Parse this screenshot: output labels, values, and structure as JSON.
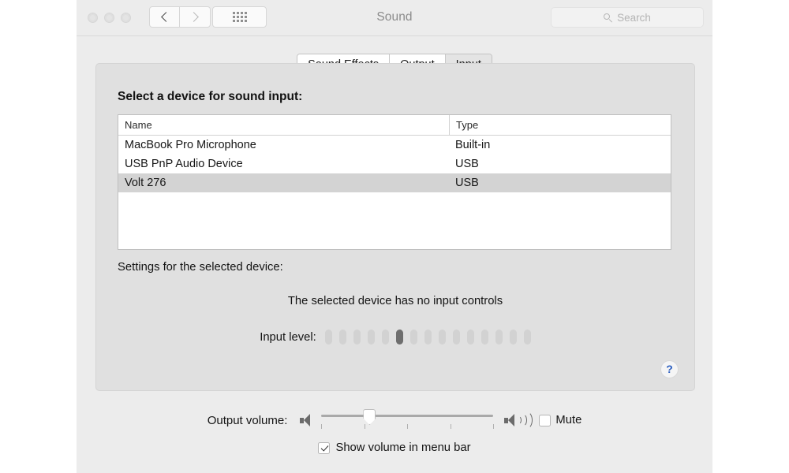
{
  "window": {
    "title": "Sound",
    "traffic_lights": [
      "close",
      "minimize",
      "zoom"
    ],
    "nav": {
      "back": "back-chevron",
      "forward": "forward-chevron",
      "grid": "show-all-grid"
    },
    "search": {
      "placeholder": "Search",
      "value": "",
      "icon": "search-icon"
    }
  },
  "tabs": [
    {
      "label": "Sound Effects",
      "selected": false
    },
    {
      "label": "Output",
      "selected": false
    },
    {
      "label": "Input",
      "selected": true
    }
  ],
  "main": {
    "section_title": "Select a device for sound input:",
    "table": {
      "columns": [
        "Name",
        "Type"
      ],
      "rows": [
        {
          "name": "MacBook Pro Microphone",
          "type": "Built-in",
          "selected": false
        },
        {
          "name": "USB PnP Audio Device",
          "type": "USB",
          "selected": false
        },
        {
          "name": "Volt 276",
          "type": "USB",
          "selected": true
        }
      ]
    },
    "settings_label": "Settings for the selected device:",
    "no_controls_message": "The selected device has no input controls",
    "input_level": {
      "label": "Input level:",
      "segments_total": 15,
      "segments_active_index": 6,
      "on_color": "#6e6e6e",
      "off_color": "#d2d2d2"
    },
    "help_button": {
      "glyph": "?",
      "color": "#2b5ec0"
    }
  },
  "footer": {
    "output_volume_label": "Output volume:",
    "slider": {
      "value_percent": 28,
      "ticks": 5
    },
    "low_icon": "speaker-low-icon",
    "high_icon": "speaker-high-icon",
    "mute": {
      "label": "Mute",
      "checked": false
    },
    "show_volume": {
      "label": "Show volume in menu bar",
      "checked": true
    }
  }
}
